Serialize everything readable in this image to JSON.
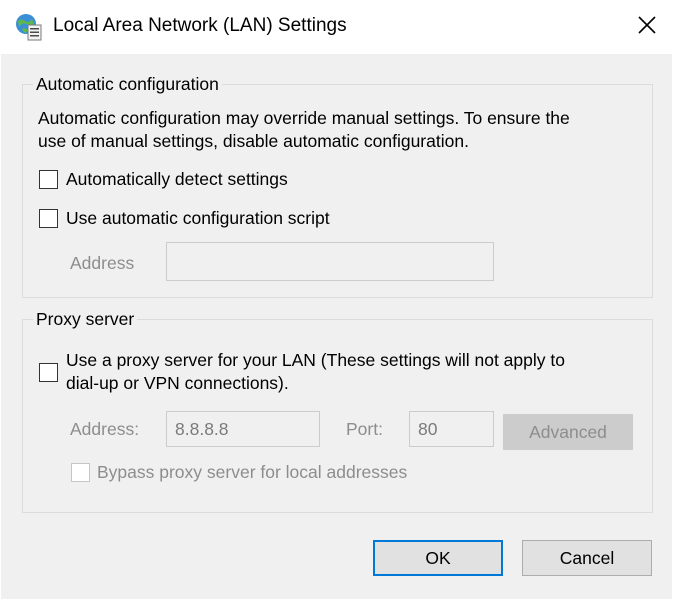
{
  "window": {
    "title": "Local Area Network (LAN) Settings",
    "icon": "network-globe-settings-icon",
    "close_icon": "close-icon"
  },
  "auto_config": {
    "legend": "Automatic configuration",
    "description_line1": "Automatic configuration may override manual settings.  To ensure the",
    "description_line2": "use of manual settings, disable automatic configuration.",
    "auto_detect_label": "Automatically detect settings",
    "auto_detect_checked": false,
    "use_script_label": "Use automatic configuration script",
    "use_script_checked": false,
    "address_label": "Address",
    "address_value": ""
  },
  "proxy": {
    "legend": "Proxy server",
    "use_proxy_label_line1": "Use a proxy server for your LAN (These settings will not apply to",
    "use_proxy_label_line2": "dial-up or VPN connections).",
    "use_proxy_checked": false,
    "address_label": "Address:",
    "address_value": "8.8.8.8",
    "port_label": "Port:",
    "port_value": "80",
    "advanced_label": "Advanced",
    "bypass_label": "Bypass proxy server for local addresses",
    "bypass_checked": false
  },
  "buttons": {
    "ok": "OK",
    "cancel": "Cancel"
  },
  "colors": {
    "accent": "#0078d7",
    "dialog_bg": "#f0f0f0",
    "disabled_text": "#8d8d8d"
  }
}
